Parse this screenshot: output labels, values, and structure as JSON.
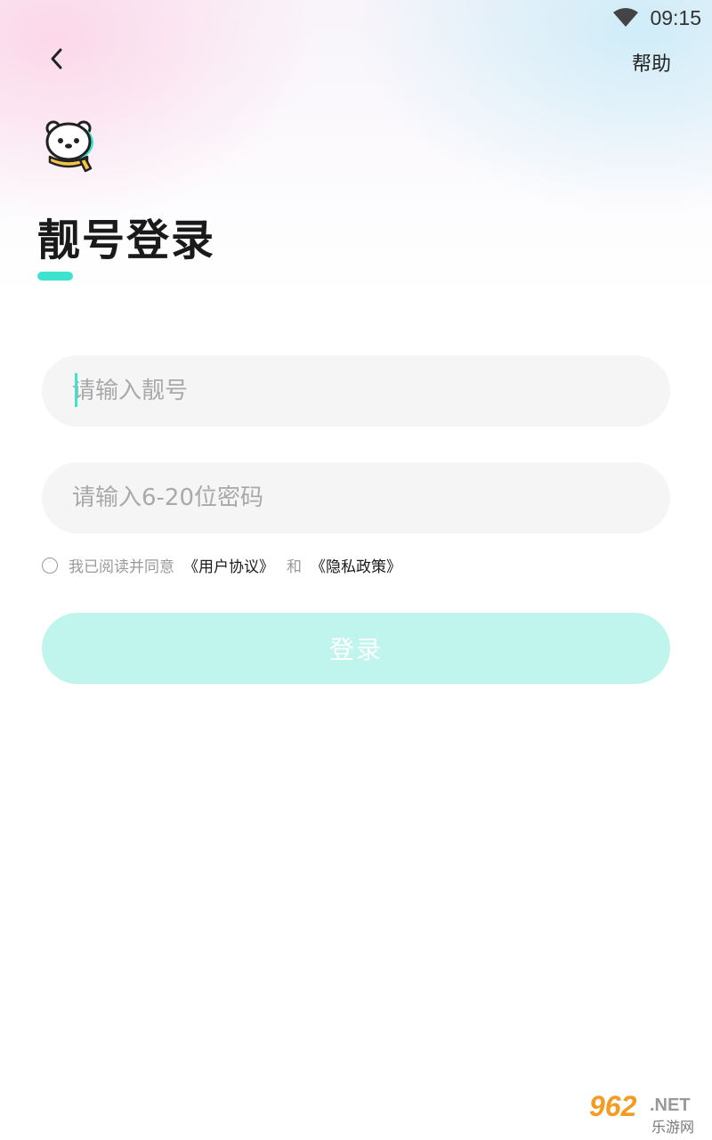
{
  "status_bar": {
    "time": "09:15",
    "wifi_icon": "wifi-icon"
  },
  "header": {
    "back_icon": "chevron-left-icon",
    "help_label": "帮助"
  },
  "page": {
    "title": "靓号登录",
    "accent_color": "#3ee3cf"
  },
  "form": {
    "account_placeholder": "请输入靓号",
    "account_value": "",
    "password_placeholder": "请输入6-20位密码",
    "password_value": "",
    "agreement": {
      "checked": false,
      "text": "我已阅读并同意",
      "user_agreement": "《用户协议》",
      "and": "和",
      "privacy_policy": "《隐私政策》"
    },
    "login_label": "登录",
    "login_color": "#c0f5ed"
  },
  "watermark": {
    "number": "962",
    "domain": ".NET",
    "name": "乐游网"
  }
}
